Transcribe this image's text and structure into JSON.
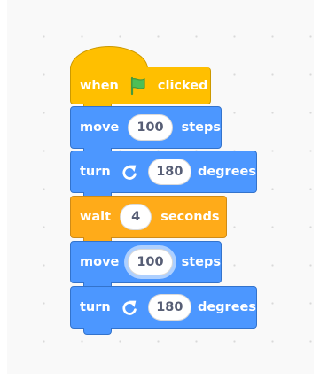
{
  "blocks": [
    {
      "category": "events",
      "parts": [
        "when",
        "clicked"
      ],
      "icon": "green-flag-icon"
    },
    {
      "category": "motion",
      "parts": [
        "move",
        "steps"
      ],
      "value": "100"
    },
    {
      "category": "motion",
      "parts": [
        "turn",
        "degrees"
      ],
      "value": "180",
      "icon": "rotate-right-icon"
    },
    {
      "category": "control",
      "parts": [
        "wait",
        "seconds"
      ],
      "value": "4"
    },
    {
      "category": "motion",
      "parts": [
        "move",
        "steps"
      ],
      "value": "100",
      "focused": true
    },
    {
      "category": "motion",
      "parts": [
        "turn",
        "degrees"
      ],
      "value": "180",
      "icon": "rotate-right-icon"
    }
  ],
  "colors": {
    "events": "#ffbf00",
    "motion": "#4c97ff",
    "control": "#ffab19",
    "flag": "#4cbf56",
    "input_text": "#575e75"
  }
}
